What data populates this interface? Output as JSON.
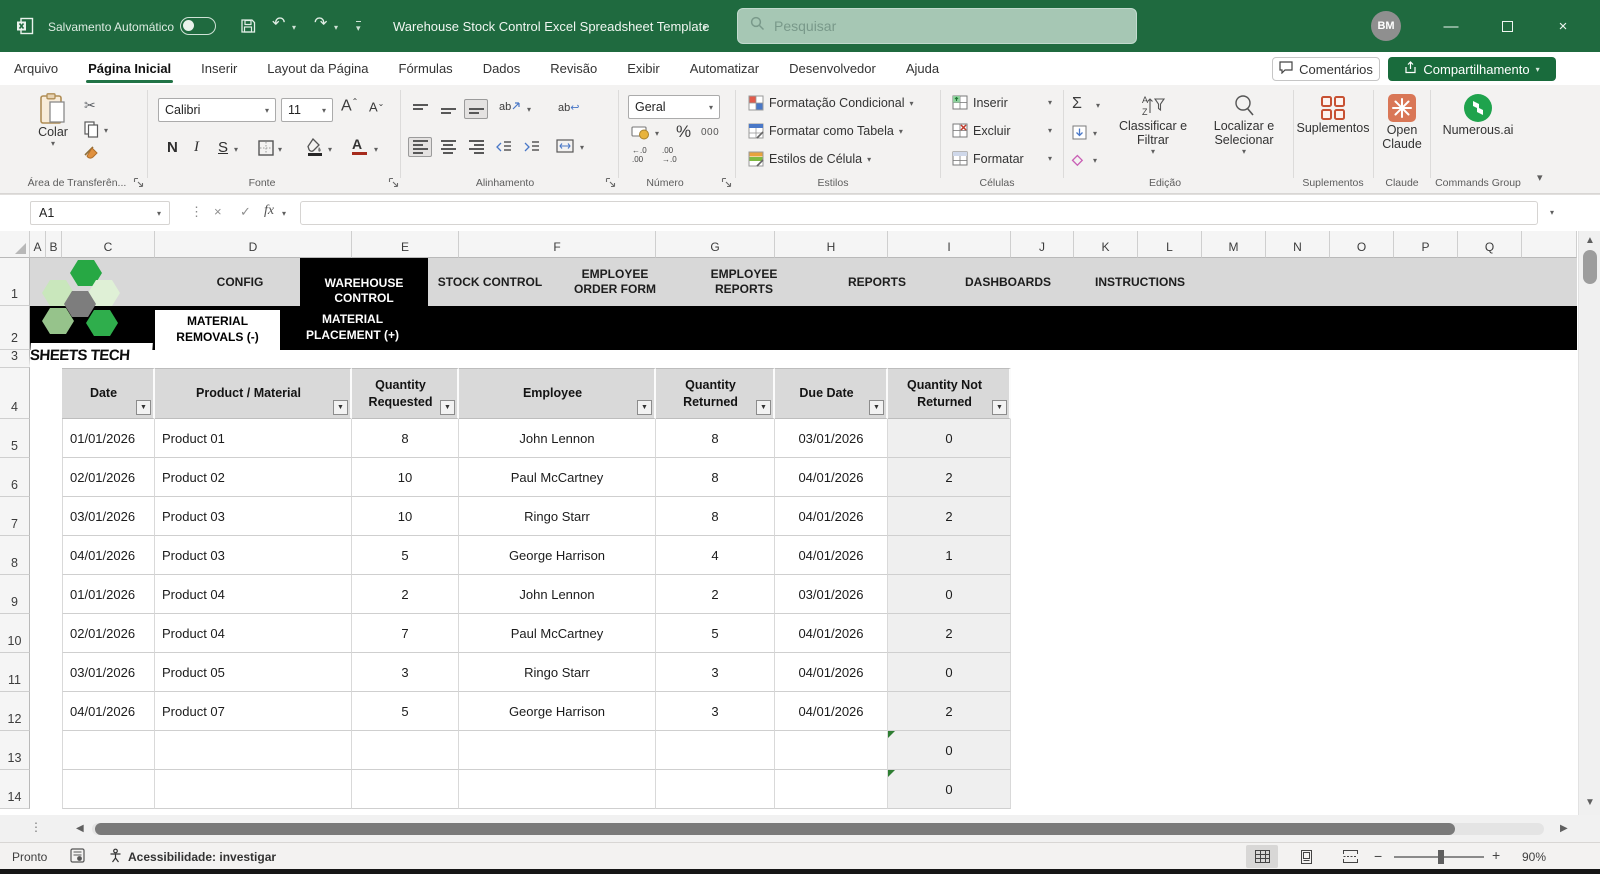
{
  "window": {
    "autosave_label": "Salvamento Automático",
    "title": "Warehouse Stock Control Excel Spreadsheet Template",
    "search_placeholder": "Pesquisar",
    "avatar_initials": "BM"
  },
  "ribbon_tabs": {
    "items": [
      "Arquivo",
      "Página Inicial",
      "Inserir",
      "Layout da Página",
      "Fórmulas",
      "Dados",
      "Revisão",
      "Exibir",
      "Automatizar",
      "Desenvolvedor",
      "Ajuda"
    ],
    "active": "Página Inicial",
    "comments": "Comentários",
    "share": "Compartilhamento"
  },
  "ribbon": {
    "clipboard": {
      "paste": "Colar",
      "group": "Área de Transferên..."
    },
    "font": {
      "family": "Calibri",
      "size": "11",
      "bold": "N",
      "italic": "I",
      "underline": "S",
      "grow": "A",
      "shrink": "A",
      "group": "Fonte"
    },
    "alignment": {
      "orientation_text": "ab",
      "wrap_text": "ab",
      "group": "Alinhamento"
    },
    "number": {
      "format": "Geral",
      "percent": "%",
      "thousands": "000",
      "dec_left_top": "←.0",
      "dec_left_bottom": ".00",
      "dec_right_top": ".00",
      "dec_right_bottom": "→.0",
      "group": "Número"
    },
    "styles": {
      "conditional": "Formatação Condicional",
      "format_table": "Formatar como Tabela",
      "cell_styles": "Estilos de Célula",
      "group": "Estilos"
    },
    "cells": {
      "insert": "Inserir",
      "delete": "Excluir",
      "format": "Formatar",
      "group": "Células"
    },
    "editing": {
      "autosum_glyph": "Σ",
      "sort": "Classificar e Filtrar",
      "find": "Localizar e Selecionar",
      "group": "Edição"
    },
    "addins": {
      "button": "Suplementos",
      "group": "Suplementos"
    },
    "claude": {
      "button": "Open Claude",
      "group": "Claude"
    },
    "numerous": {
      "button": "Numerous.ai",
      "group": "Commands Group"
    }
  },
  "formula_bar": {
    "name_box": "A1",
    "fx": "fx",
    "value": ""
  },
  "grid": {
    "columns": [
      "A",
      "B",
      "C",
      "D",
      "E",
      "F",
      "G",
      "H",
      "I",
      "J",
      "K",
      "L",
      "M",
      "N",
      "O",
      "P",
      "Q"
    ],
    "row_numbers": [
      "1",
      "2",
      "3",
      "4",
      "5",
      "6",
      "7",
      "8",
      "9",
      "10",
      "11",
      "12",
      "13",
      "14"
    ]
  },
  "nav": {
    "logo_text": "SHEETS TECH",
    "tabs": [
      {
        "label": "CONFIG"
      },
      {
        "label": "WAREHOUSE CONTROL"
      },
      {
        "label": "STOCK CONTROL"
      },
      {
        "label": "EMPLOYEE ORDER FORM"
      },
      {
        "label": "EMPLOYEE REPORTS"
      },
      {
        "label": "REPORTS"
      },
      {
        "label": "DASHBOARDS"
      },
      {
        "label": "INSTRUCTIONS"
      }
    ],
    "active_tab": "WAREHOUSE CONTROL",
    "subtabs": [
      {
        "label": "MATERIAL REMOVALS (-)"
      },
      {
        "label": "MATERIAL PLACEMENT (+)"
      }
    ],
    "active_subtab": "MATERIAL REMOVALS (-)"
  },
  "table": {
    "headers": [
      "Date",
      "Product / Material",
      "Quantity Requested",
      "Employee",
      "Quantity Returned",
      "Due Date",
      "Quantity Not Returned"
    ],
    "rows": [
      {
        "date": "01/01/2026",
        "product": "Product 01",
        "qty_requested": "8",
        "employee": "John Lennon",
        "qty_returned": "8",
        "due_date": "03/01/2026",
        "qty_not_returned": "0"
      },
      {
        "date": "02/01/2026",
        "product": "Product 02",
        "qty_requested": "10",
        "employee": "Paul McCartney",
        "qty_returned": "8",
        "due_date": "04/01/2026",
        "qty_not_returned": "2"
      },
      {
        "date": "03/01/2026",
        "product": "Product 03",
        "qty_requested": "10",
        "employee": "Ringo Starr",
        "qty_returned": "8",
        "due_date": "04/01/2026",
        "qty_not_returned": "2"
      },
      {
        "date": "04/01/2026",
        "product": "Product 03",
        "qty_requested": "5",
        "employee": "George Harrison",
        "qty_returned": "4",
        "due_date": "04/01/2026",
        "qty_not_returned": "1"
      },
      {
        "date": "01/01/2026",
        "product": "Product 04",
        "qty_requested": "2",
        "employee": "John Lennon",
        "qty_returned": "2",
        "due_date": "03/01/2026",
        "qty_not_returned": "0"
      },
      {
        "date": "02/01/2026",
        "product": "Product 04",
        "qty_requested": "7",
        "employee": "Paul McCartney",
        "qty_returned": "5",
        "due_date": "04/01/2026",
        "qty_not_returned": "2"
      },
      {
        "date": "03/01/2026",
        "product": "Product 05",
        "qty_requested": "3",
        "employee": "Ringo Starr",
        "qty_returned": "3",
        "due_date": "04/01/2026",
        "qty_not_returned": "0"
      },
      {
        "date": "04/01/2026",
        "product": "Product 07",
        "qty_requested": "5",
        "employee": "George Harrison",
        "qty_returned": "3",
        "due_date": "04/01/2026",
        "qty_not_returned": "2"
      },
      {
        "date": "",
        "product": "",
        "qty_requested": "",
        "employee": "",
        "qty_returned": "",
        "due_date": "",
        "qty_not_returned": "0"
      },
      {
        "date": "",
        "product": "",
        "qty_requested": "",
        "employee": "",
        "qty_returned": "",
        "due_date": "",
        "qty_not_returned": "0"
      }
    ]
  },
  "status_bar": {
    "ready": "Pronto",
    "accessibility": "Acessibilidade: investigar",
    "zoom": "90%"
  },
  "colors": {
    "titlebar_green": "#1f6a3f",
    "accent_green": "#217346",
    "share_green": "#196b3c",
    "nav_gray": "#d8d8d8",
    "nav_black": "#000000",
    "table_header_gray": "#d9d9d9",
    "last_column_bg": "#efefef",
    "error_triangle_green": "#2e7d32"
  }
}
